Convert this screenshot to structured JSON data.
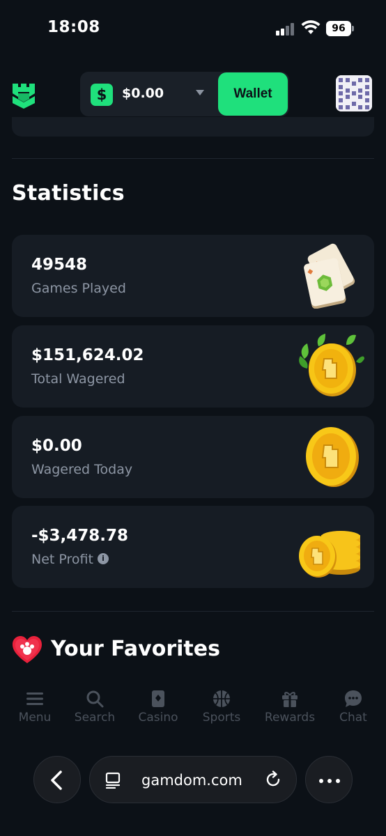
{
  "status_bar": {
    "time": "18:08",
    "battery": "96"
  },
  "header": {
    "currency_symbol": "$",
    "balance": "$0.00",
    "wallet_label": "Wallet",
    "brand_color": "#1fe07c"
  },
  "statistics": {
    "title": "Statistics",
    "cards": [
      {
        "value": "49548",
        "label": "Games Played",
        "icon": "mahjong-tiles-icon"
      },
      {
        "value": "$151,624.02",
        "label": "Total Wagered",
        "icon": "coin-leaves-icon"
      },
      {
        "value": "$0.00",
        "label": "Wagered Today",
        "icon": "gold-coin-icon"
      },
      {
        "value": "-$3,478.78",
        "label": "Net Profit",
        "icon": "coin-stack-icon"
      }
    ]
  },
  "favorites": {
    "title": "Your Favorites",
    "icon": "heart-icon"
  },
  "bottom_nav": {
    "items": [
      {
        "label": "Menu",
        "icon": "menu-icon"
      },
      {
        "label": "Search",
        "icon": "search-icon"
      },
      {
        "label": "Casino",
        "icon": "casino-icon"
      },
      {
        "label": "Sports",
        "icon": "sports-icon"
      },
      {
        "label": "Rewards",
        "icon": "rewards-icon"
      },
      {
        "label": "Chat",
        "icon": "chat-icon"
      }
    ]
  },
  "browser": {
    "url": "gamdom.com"
  }
}
